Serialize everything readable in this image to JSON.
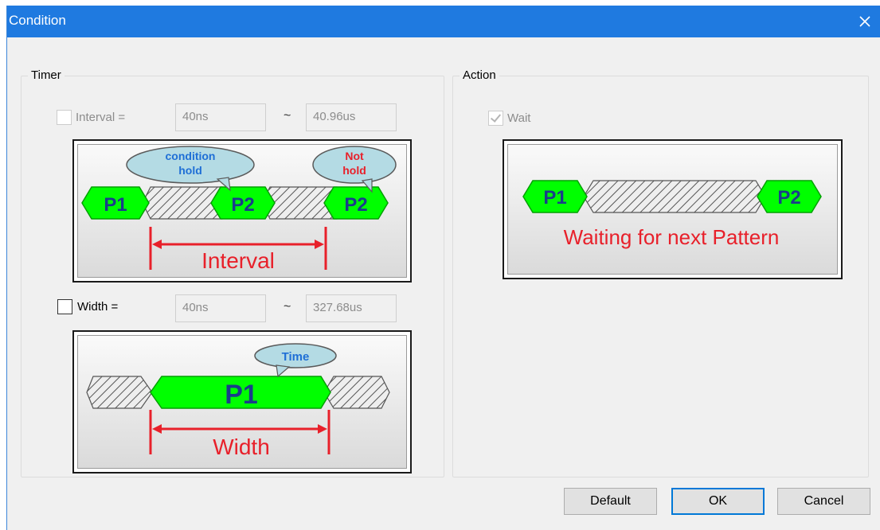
{
  "dialog": {
    "title": "Condition"
  },
  "timer": {
    "legend": "Timer",
    "interval": {
      "label": "Interval =",
      "min": "40ns",
      "tilde": "~",
      "max": "40.96us",
      "checked": false
    },
    "interval_diagram": {
      "p1": "P1",
      "p2a": "P2",
      "p2b": "P2",
      "bubble_hold_line1": "condition",
      "bubble_hold_line2": "hold",
      "bubble_not_line1": "Not",
      "bubble_not_line2": "hold",
      "caption": "Interval"
    },
    "width": {
      "label": "Width =",
      "min": "40ns",
      "tilde": "~",
      "max": "327.68us",
      "checked": false
    },
    "width_diagram": {
      "p1": "P1",
      "bubble": "Time",
      "caption": "Width"
    }
  },
  "action": {
    "legend": "Action",
    "wait": {
      "label": "Wait",
      "checked": true
    },
    "diagram": {
      "p1": "P1",
      "p2": "P2",
      "caption": "Waiting for next Pattern"
    }
  },
  "buttons": {
    "default": "Default",
    "ok": "OK",
    "cancel": "Cancel"
  },
  "colors": {
    "titlebar": "#1f7ae0",
    "pattern": "#00ff00",
    "marker": "#e8202a",
    "bubble": "#b4dbe4",
    "bubble_text_blue": "#1f6fd6",
    "bubble_text_red": "#e8202a"
  }
}
